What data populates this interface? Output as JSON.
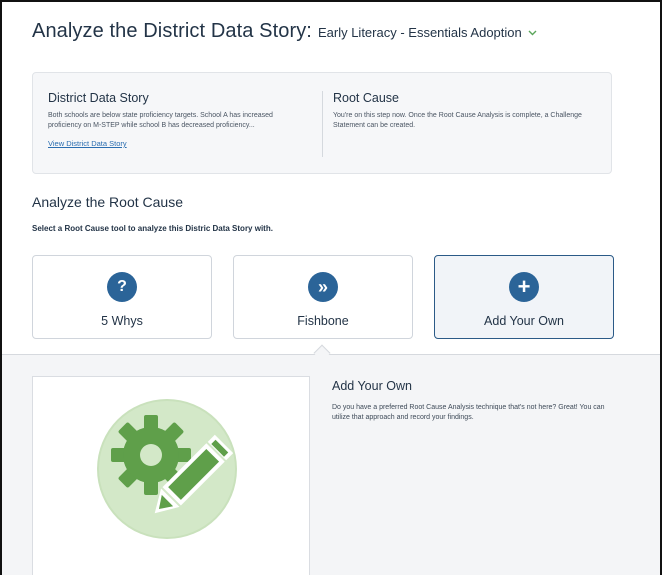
{
  "header": {
    "title": "Analyze the District Data Story:",
    "story_name": "Early Literacy - Essentials Adoption",
    "dropdown_icon": "chevron-down-icon",
    "accent_color": "#5aa55a"
  },
  "info": {
    "left": {
      "heading": "District Data Story",
      "body": "Both schools are below state proficiency targets. School A has increased proficiency on M-STEP while school B has decreased proficiency...",
      "link": "View District Data Story"
    },
    "right": {
      "heading": "Root Cause",
      "body": "You're on this step now. Once the Root Cause Analysis is complete, a Challenge Statement can be created."
    }
  },
  "section": {
    "title": "Analyze the Root Cause",
    "subtitle": "Select a Root Cause tool to analyze this Distric Data Story with."
  },
  "tools": [
    {
      "label": "5 Whys",
      "icon": "question-icon",
      "glyph": "?",
      "selected": false
    },
    {
      "label": "Fishbone",
      "icon": "double-chevron-right-icon",
      "glyph": "»",
      "selected": false
    },
    {
      "label": "Add Your Own",
      "icon": "plus-icon",
      "glyph": "+",
      "selected": true
    }
  ],
  "detail": {
    "title": "Add Your Own",
    "body": "Do you have a preferred Root Cause Analysis technique that's not here? Great! You can utilize that approach and record your findings.",
    "illustration": "gear-pencil-icon",
    "brand_color": "#2b6498",
    "illustration_color": "#5f9f4a"
  }
}
